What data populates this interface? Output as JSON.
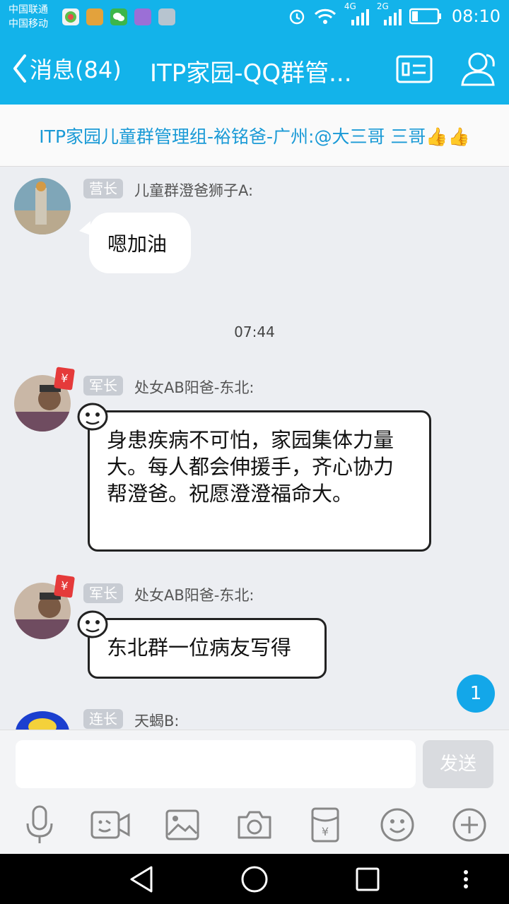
{
  "status_bar": {
    "carrier_1": "中国联通",
    "carrier_2": "中国移动",
    "net_1": "4G",
    "net_2": "2G",
    "time": "08:10"
  },
  "header": {
    "back_label": "消息(84)",
    "title": "ITP家园-QQ群管...",
    "card_icon": "profile-card-icon",
    "members_icon": "group-members-icon"
  },
  "announcement": {
    "text": "ITP家园儿童群管理组-裕铭爸-广州:@大三哥 三哥👍👍"
  },
  "messages": [
    {
      "rank": "营长",
      "sender": "儿童群澄爸狮子A:",
      "text": "嗯加油",
      "style": "plain"
    },
    {
      "timestamp": "07:44"
    },
    {
      "rank": "军长",
      "sender": "处女AB阳爸-东北:",
      "text": "身患疾病不可怕，家园集体力量大。每人都会伸援手，齐心协力帮澄爸。祝愿澄澄福命大。",
      "style": "comic",
      "badge": "¥"
    },
    {
      "rank": "军长",
      "sender": "处女AB阳爸-东北:",
      "text": "东北群一位病友写得",
      "style": "comic",
      "badge": "¥"
    },
    {
      "rank": "连长",
      "sender": "天蝎B:"
    }
  ],
  "unread_count": "1",
  "composer": {
    "value": "",
    "send_label": "发送"
  },
  "toolbar_icons": [
    "microphone-icon",
    "video-emoji-icon",
    "image-icon",
    "camera-icon",
    "red-packet-icon",
    "emoji-icon",
    "plus-icon"
  ],
  "colors": {
    "brand": "#13b3ea",
    "announcement_text": "#1a9ad6",
    "badge_red": "#e53a3a"
  }
}
